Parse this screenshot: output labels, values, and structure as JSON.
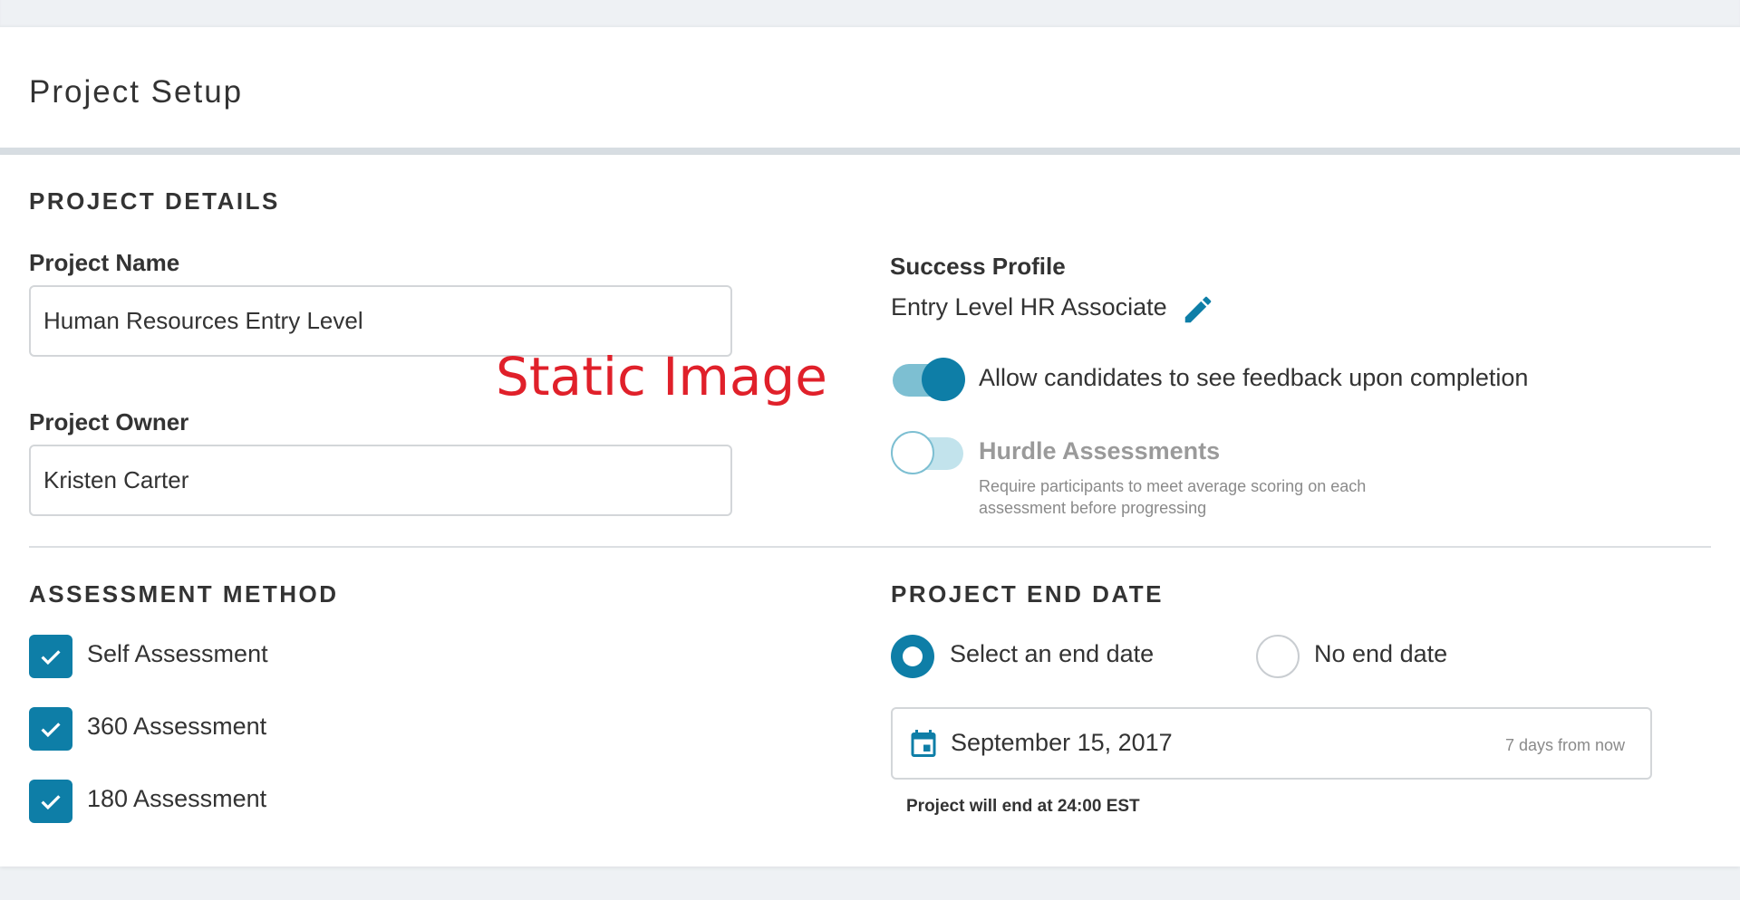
{
  "page": {
    "title": "Project Setup"
  },
  "project_details": {
    "heading": "PROJECT DETAILS",
    "project_name": {
      "label": "Project Name",
      "value": "Human Resources Entry Level"
    },
    "project_owner": {
      "label": "Project Owner",
      "value": "Kristen Carter"
    },
    "overlay_text": "Static Image"
  },
  "success_profile": {
    "label": "Success Profile",
    "value": "Entry Level HR Associate",
    "edit_icon": "pencil-icon"
  },
  "toggles": {
    "feedback": {
      "label": "Allow candidates to see feedback upon completion",
      "on": true
    },
    "hurdle": {
      "label": "Hurdle Assessments",
      "on": false,
      "help_line1": "Require participants to meet average scoring  on each",
      "help_line2": "assessment before progressing"
    }
  },
  "assessment_method": {
    "heading": "ASSESSMENT METHOD",
    "options": [
      {
        "label": "Self Assessment",
        "checked": true
      },
      {
        "label": "360 Assessment",
        "checked": true
      },
      {
        "label": "180 Assessment",
        "checked": true
      }
    ]
  },
  "project_end_date": {
    "heading": "PROJECT END DATE",
    "radio_select": {
      "label": "Select an end date",
      "selected": true
    },
    "radio_none": {
      "label": "No end date",
      "selected": false
    },
    "date_value": "September 15, 2017",
    "date_hint": "7 days from now",
    "calendar_icon": "calendar-icon",
    "note": "Project will end at 24:00 EST"
  },
  "colors": {
    "accent": "#0e7ea7",
    "toggle_track_on": "#7dbfd2",
    "toggle_track_off": "#c2e3ec",
    "overlay_red": "#e0202a"
  }
}
